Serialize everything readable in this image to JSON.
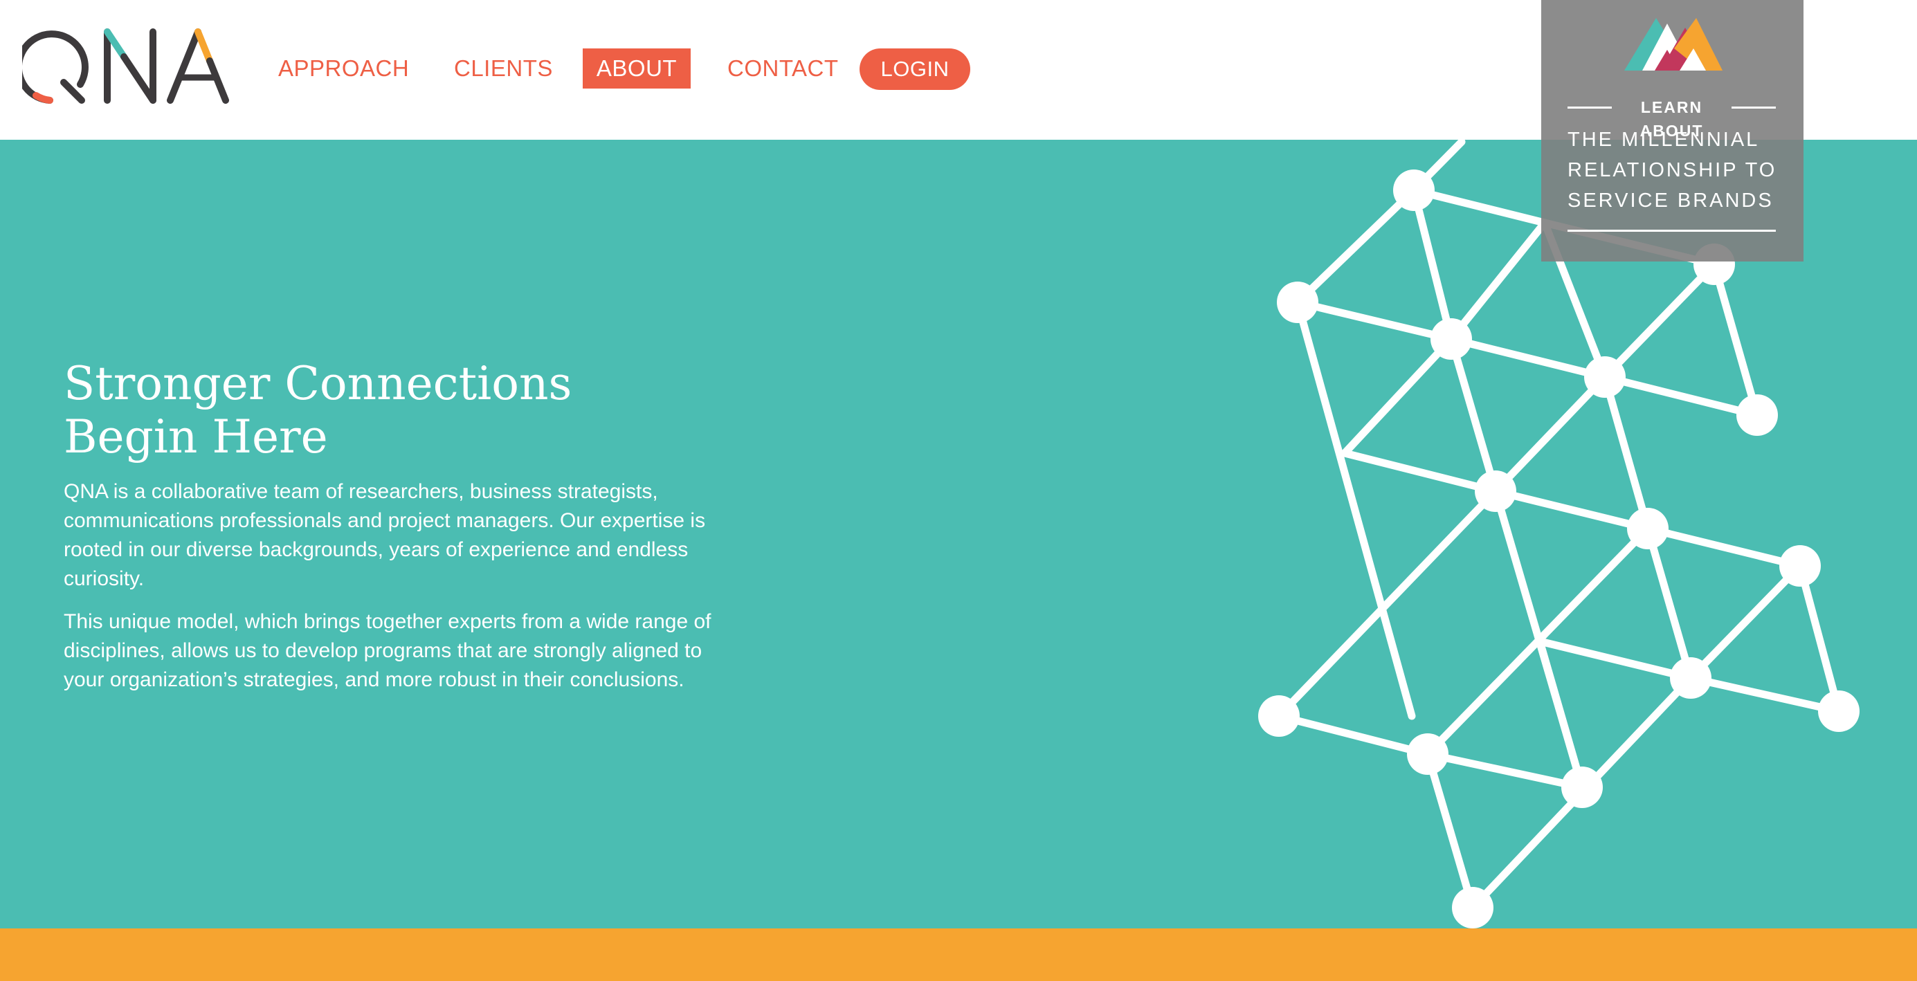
{
  "brand": {
    "name": "QNA",
    "colors": {
      "coral": "#ee5f45",
      "teal": "#4bbdb2",
      "orange": "#f6a430",
      "charcoal": "#3d3a3c",
      "promo_gray": "#808080"
    }
  },
  "nav": {
    "items": [
      {
        "label": "APPROACH",
        "active": false
      },
      {
        "label": "CLIENTS",
        "active": false
      },
      {
        "label": "ABOUT",
        "active": true
      },
      {
        "label": "CONTACT",
        "active": false
      }
    ],
    "login_label": "LOGIN"
  },
  "promo": {
    "logo_icon": "millennial-mountains-logo",
    "kicker": "LEARN ABOUT",
    "title": "THE MILLENNIAL RELATIONSHIP TO SERVICE BRANDS"
  },
  "hero": {
    "headline": "Stronger Connections Begin Here",
    "paragraphs": [
      "QNA is a collaborative team of researchers, business strategists, communications professionals and project managers. Our expertise is rooted in our diverse backgrounds, years of experience and endless curiosity.",
      "This unique model, which brings together experts from a wide range of disciplines, allows us to develop programs that are strongly aligned to your organization’s strategies, and more robust in their conclusions."
    ],
    "graphic_icon": "network-nodes-graphic"
  }
}
